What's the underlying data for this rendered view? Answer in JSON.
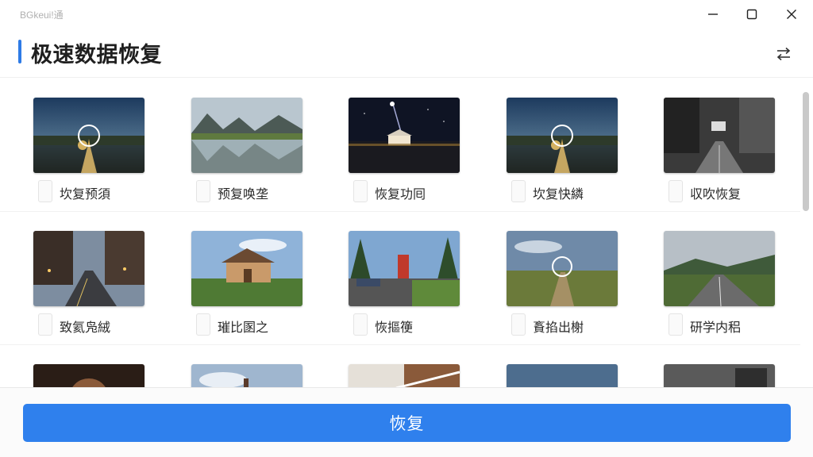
{
  "window": {
    "app_name": "BGkeui!通",
    "controls": [
      "minimize-icon",
      "maximize-icon",
      "close-icon"
    ]
  },
  "header": {
    "title": "极速数据恢复",
    "accent_color": "#2e7be6",
    "switch_icon": "swap-arrows-icon"
  },
  "grid": {
    "items": [
      {
        "caption": "坎复预須",
        "scene": "night-road-glow"
      },
      {
        "caption": "预复唤垄",
        "scene": "mountain-lake"
      },
      {
        "caption": "恢复功囘",
        "scene": "night-stage-star"
      },
      {
        "caption": "坎复快繗",
        "scene": "night-road-glow"
      },
      {
        "caption": "収吹恢复",
        "scene": "city-street-bw"
      },
      {
        "caption": "致氦凫絨",
        "scene": "city-street-dusk"
      },
      {
        "caption": "璀比圂之",
        "scene": "house-lawn"
      },
      {
        "caption": "恢摳箯",
        "scene": "forest-parking"
      },
      {
        "caption": "賌掐出榭",
        "scene": "field-path-ring"
      },
      {
        "caption": "研学内稆",
        "scene": "country-road"
      },
      {
        "caption": "",
        "scene": "portrait-dark"
      },
      {
        "caption": "",
        "scene": "sky-figure"
      },
      {
        "caption": "",
        "scene": "interior-wood"
      },
      {
        "caption": "",
        "scene": "blue-sky"
      },
      {
        "caption": "",
        "scene": "building-gray"
      }
    ]
  },
  "footer": {
    "restore_label": "恢复",
    "button_color": "#2f80ed"
  }
}
